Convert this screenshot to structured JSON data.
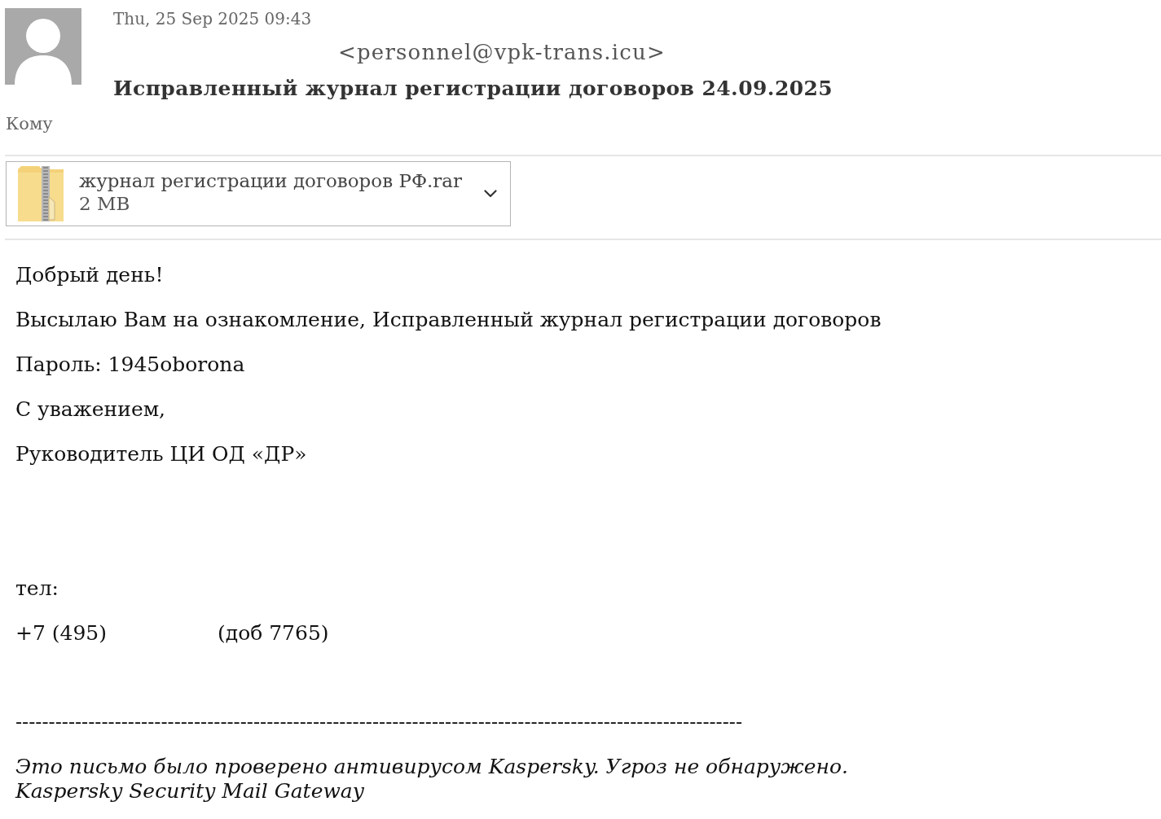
{
  "header": {
    "date": "Thu, 25 Sep 2025 09:43",
    "sender": "<personnel@vpk-trans.icu>",
    "subject": "Исправленный журнал регистрации договоров 24.09.2025",
    "to_label": "Кому"
  },
  "attachment": {
    "name": "журнал регистрации договоров РФ.rar",
    "size": "2 MB"
  },
  "body": {
    "paragraphs": [
      "Добрый день!",
      "Высылаю Вам на ознакомление, Исправленный журнал регистрации договоров",
      "Пароль: 1945oborona",
      "С уважением,",
      "Руководитель ЦИ ОД «ДР»"
    ],
    "contact": {
      "label": "тел:",
      "phone": "+7 (495)",
      "extension": "(доб 7765)"
    },
    "separator": "--------------------------------------------------------------------------------------------------------------",
    "footer": [
      "Это письмо было проверено антивирусом Kaspersky. Угроз не обнаружено.",
      "Kaspersky Security Mail Gateway"
    ]
  }
}
